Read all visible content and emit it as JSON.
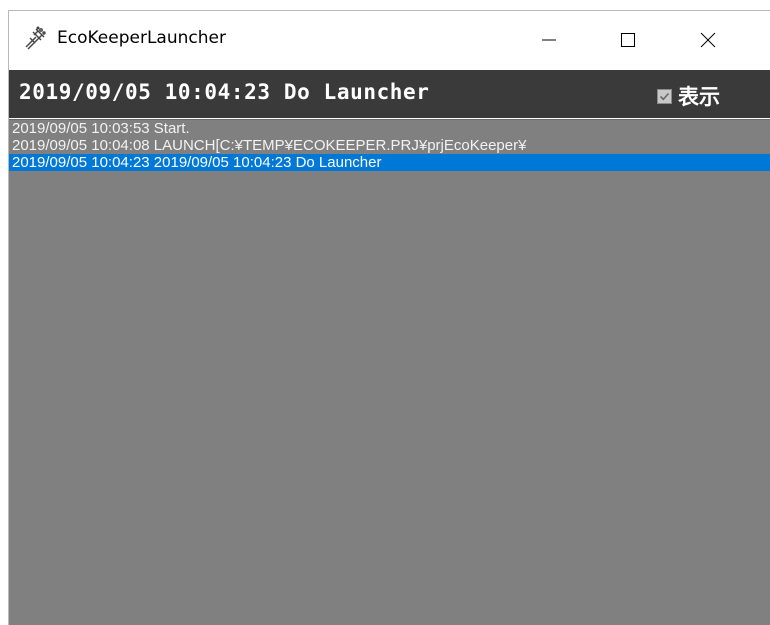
{
  "window": {
    "title": "EcoKeeperLauncher",
    "icon": "spray-icon",
    "controls": {
      "minimize_icon": "minimize-icon",
      "maximize_icon": "maximize-icon",
      "close_icon": "close-icon"
    }
  },
  "status": {
    "text": "2019/09/05 10:04:23 Do Launcher",
    "show_label": "表示",
    "show_checked": true
  },
  "log": {
    "lines": [
      "2019/09/05 10:03:53 Start.",
      "2019/09/05 10:04:08 LAUNCH[C:¥TEMP¥ECOKEEPER.PRJ¥prjEcoKeeper¥",
      "2019/09/05 10:04:23 2019/09/05 10:04:23 Do Launcher"
    ],
    "selected_index": 2
  },
  "colors": {
    "status_bar": "#3a3a3a",
    "log_background": "#808080",
    "selection": "#0078d7"
  }
}
